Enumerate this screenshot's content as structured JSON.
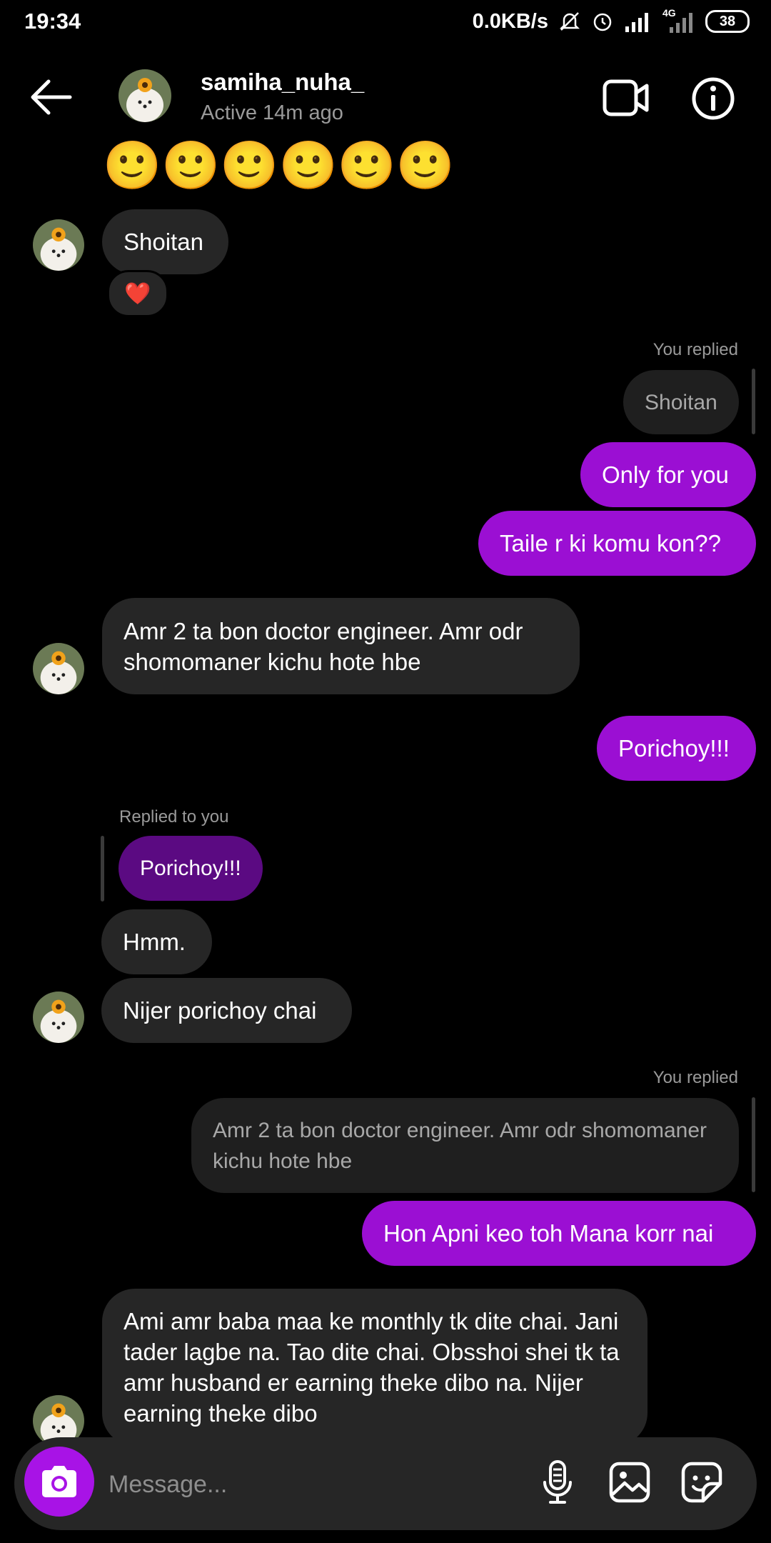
{
  "status_bar": {
    "time": "19:34",
    "net_speed": "0.0KB/s",
    "network_type": "4G",
    "battery": "38"
  },
  "header": {
    "username": "samiha_nuha_",
    "active_status": "Active 14m ago"
  },
  "messages": {
    "emoji_row": "🙂🙂🙂🙂🙂🙂",
    "m1": "Shoitan",
    "m1_reaction": "❤️",
    "reply1_label": "You replied",
    "reply1_quote": "Shoitan",
    "m2": "Only for you",
    "m3": "Taile r ki komu kon??",
    "m4": "Amr 2 ta bon doctor engineer. Amr odr shomomaner kichu hote hbe",
    "m5": "Porichoy!!!",
    "reply2_label": "Replied to you",
    "reply2_quote": "Porichoy!!!",
    "m6": "Hmm.",
    "m7": "Nijer porichoy chai",
    "reply3_label": "You replied",
    "reply3_quote": "Amr 2 ta bon doctor engineer. Amr odr shomomaner kichu hote hbe",
    "m8": "Hon Apni keo toh Mana korr nai",
    "m9": "Ami amr baba maa ke monthly tk dite chai. Jani tader lagbe na. Tao dite chai. Obsshoi shei tk ta amr husband er earning theke dibo na. Nijer earning theke dibo"
  },
  "composer": {
    "placeholder": "Message..."
  },
  "icons": {
    "back": "arrow-left-icon",
    "video": "video-camera-icon",
    "info": "info-icon",
    "camera": "camera-icon",
    "mic": "microphone-icon",
    "gallery": "image-icon",
    "sticker": "sticker-icon"
  },
  "colors": {
    "background": "#000000",
    "incoming_bubble": "#262626",
    "outgoing_bubble": "#9b0fd3",
    "camera_button": "#a813e6"
  }
}
